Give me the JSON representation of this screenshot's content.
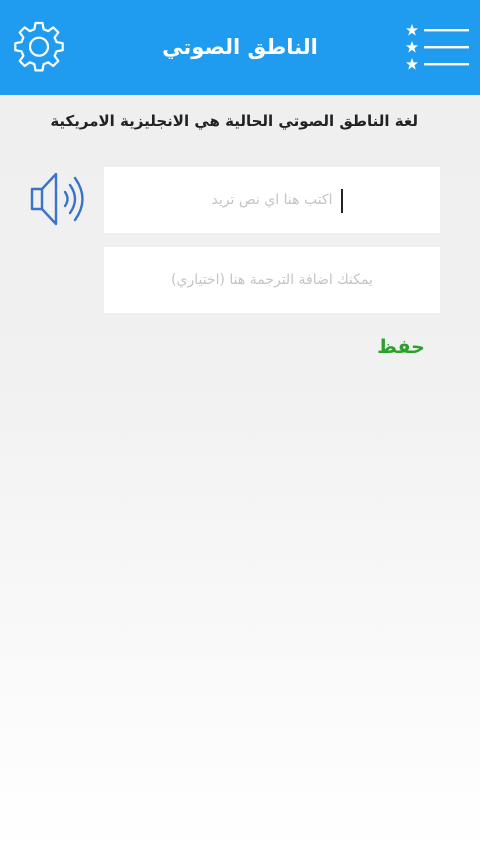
{
  "header": {
    "title": "الناطق الصوتي",
    "background_color": "#1f9cf0",
    "left_icon": "gear-icon",
    "right_icon": "starred-menu-icon"
  },
  "status": {
    "text": "لغة الناطق الصوتي الحالية هي الانجليزية الامريكية"
  },
  "speaker": {
    "icon": "speaker-icon",
    "color": "#3a74c9"
  },
  "form": {
    "text_placeholder": "اكتب هنا اي نص تريد",
    "text_value": "",
    "translation_placeholder": "يمكنك اضافة الترجمة هنا (اختياري)",
    "translation_value": ""
  },
  "actions": {
    "save_label": "حفظ",
    "save_color": "#2aa12a"
  }
}
